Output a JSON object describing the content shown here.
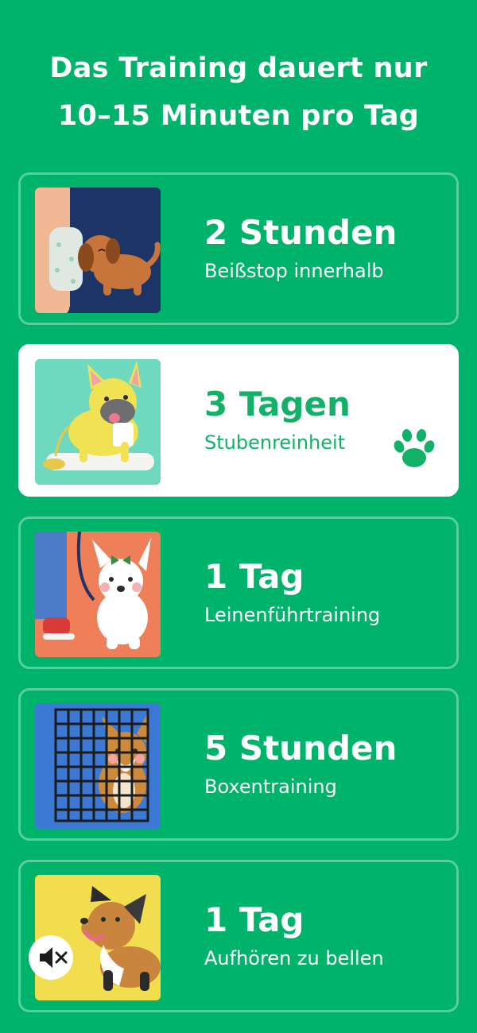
{
  "header": {
    "line1": "Das Training dauert nur",
    "line2": "10–15 Minuten pro Tag"
  },
  "cards": [
    {
      "title": "2 Stunden",
      "subtitle": "Beißstop innerhalb",
      "image": "puppy-biting-foot-illustration",
      "selected": false
    },
    {
      "title": "3 Tagen",
      "subtitle": "Stubenreinheit",
      "image": "french-bulldog-peeing-on-pad-illustration",
      "selected": true
    },
    {
      "title": "1 Tag",
      "subtitle": "Leinenführtraining",
      "image": "white-dog-on-leash-illustration",
      "selected": false
    },
    {
      "title": "5 Stunden",
      "subtitle": "Boxentraining",
      "image": "corgi-in-crate-illustration",
      "selected": false
    },
    {
      "title": "1 Tag",
      "subtitle": "Aufhören zu bellen",
      "image": "barking-dog-with-mute-icon-illustration",
      "selected": false
    }
  ],
  "icons": {
    "selected_marker": "paw-icon",
    "mute": "speaker-mute-icon"
  },
  "colors": {
    "background": "#00b36b",
    "selected_card": "#ffffff",
    "selected_text": "#12b168"
  }
}
